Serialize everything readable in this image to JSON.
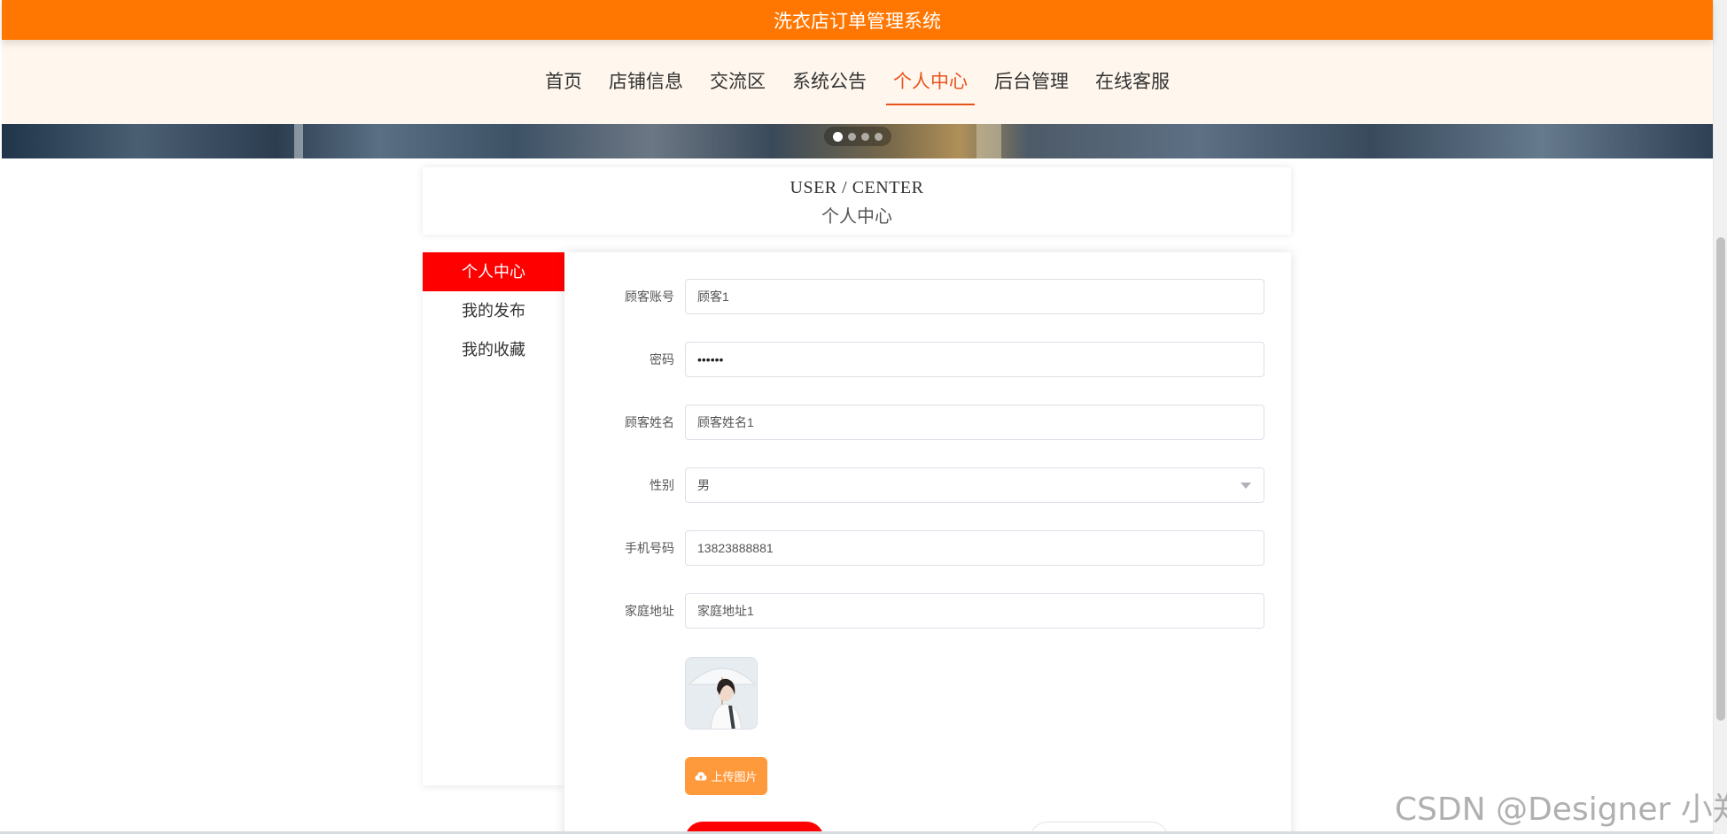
{
  "header": {
    "title": "洗衣店订单管理系统"
  },
  "nav": {
    "items": [
      {
        "label": "首页"
      },
      {
        "label": "店铺信息"
      },
      {
        "label": "交流区"
      },
      {
        "label": "系统公告"
      },
      {
        "label": "个人中心",
        "active": true
      },
      {
        "label": "后台管理"
      },
      {
        "label": "在线客服"
      }
    ]
  },
  "banner": {
    "slide_count": 4,
    "active_slide": 1
  },
  "page_title": {
    "en": "USER / CENTER",
    "cn": "个人中心"
  },
  "sidebar": {
    "items": [
      {
        "label": "个人中心",
        "active": true
      },
      {
        "label": "我的发布"
      },
      {
        "label": "我的收藏"
      }
    ]
  },
  "form": {
    "account": {
      "label": "顾客账号",
      "value": "顾客1"
    },
    "password": {
      "label": "密码",
      "value": "••••••"
    },
    "name": {
      "label": "顾客姓名",
      "value": "顾客姓名1"
    },
    "gender": {
      "label": "性别",
      "value": "男"
    },
    "phone": {
      "label": "手机号码",
      "value": "13823888881"
    },
    "address": {
      "label": "家庭地址",
      "value": "家庭地址1"
    },
    "upload_label": "上传图片"
  },
  "watermark": "CSDN @Designer 小郑",
  "colors": {
    "accent": "#ff7700",
    "active_nav": "#e8531c",
    "menu_active": "#ff0000",
    "nav_bg": "#fff7ed",
    "upload": "#ff9a3c"
  }
}
